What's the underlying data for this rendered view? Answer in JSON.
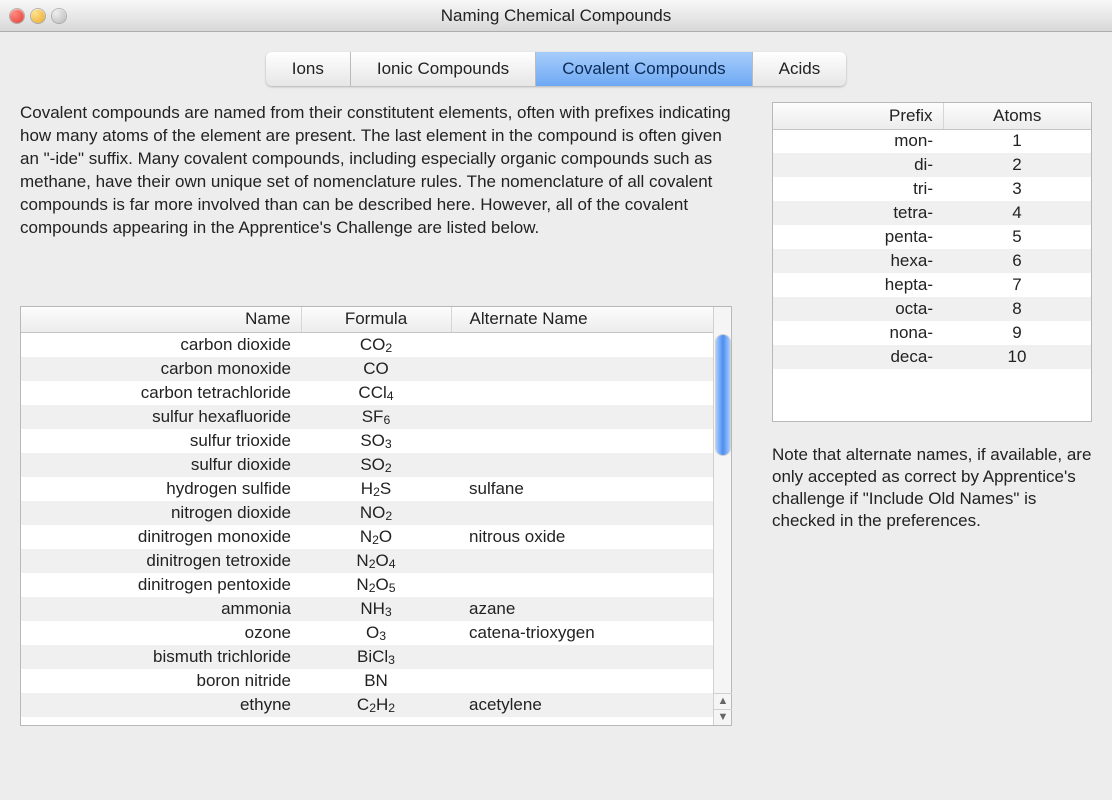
{
  "window": {
    "title": "Naming Chemical Compounds"
  },
  "tabs": [
    {
      "label": "Ions",
      "active": false
    },
    {
      "label": "Ionic Compounds",
      "active": false
    },
    {
      "label": "Covalent Compounds",
      "active": true
    },
    {
      "label": "Acids",
      "active": false
    }
  ],
  "intro": "Covalent compounds are named from their constitutent elements, often with prefixes indicating how many atoms of the element are present.  The last element in the compound is often given an \"-ide\" suffix.  Many covalent compounds, including especially organic compounds such as methane, have their own unique set of nomenclature rules.  The nomenclature of all covalent compounds is far more involved than can be described here.  However, all of the covalent compounds appearing in the Apprentice's Challenge are listed below.",
  "compounds_table": {
    "headers": {
      "name": "Name",
      "formula": "Formula",
      "alt": "Alternate Name"
    },
    "rows": [
      {
        "name": "carbon dioxide",
        "formula": "CO<sub>2</sub>",
        "alt": ""
      },
      {
        "name": "carbon monoxide",
        "formula": "CO",
        "alt": ""
      },
      {
        "name": "carbon tetrachloride",
        "formula": "CCl<sub>4</sub>",
        "alt": ""
      },
      {
        "name": "sulfur hexafluoride",
        "formula": "SF<sub>6</sub>",
        "alt": ""
      },
      {
        "name": "sulfur trioxide",
        "formula": "SO<sub>3</sub>",
        "alt": ""
      },
      {
        "name": "sulfur dioxide",
        "formula": "SO<sub>2</sub>",
        "alt": ""
      },
      {
        "name": "hydrogen sulfide",
        "formula": "H<sub>2</sub>S",
        "alt": "sulfane"
      },
      {
        "name": "nitrogen dioxide",
        "formula": "NO<sub>2</sub>",
        "alt": ""
      },
      {
        "name": "dinitrogen monoxide",
        "formula": "N<sub>2</sub>O",
        "alt": "nitrous oxide"
      },
      {
        "name": "dinitrogen tetroxide",
        "formula": "N<sub>2</sub>O<sub>4</sub>",
        "alt": ""
      },
      {
        "name": "dinitrogen pentoxide",
        "formula": "N<sub>2</sub>O<sub>5</sub>",
        "alt": ""
      },
      {
        "name": "ammonia",
        "formula": "NH<sub>3</sub>",
        "alt": "azane"
      },
      {
        "name": "ozone",
        "formula": "O<sub>3</sub>",
        "alt": "catena-trioxygen"
      },
      {
        "name": "bismuth trichloride",
        "formula": "BiCl<sub>3</sub>",
        "alt": ""
      },
      {
        "name": "boron nitride",
        "formula": "BN",
        "alt": ""
      },
      {
        "name": "ethyne",
        "formula": "C<sub>2</sub>H<sub>2</sub>",
        "alt": "acetylene"
      }
    ]
  },
  "prefix_table": {
    "headers": {
      "prefix": "Prefix",
      "atoms": "Atoms"
    },
    "rows": [
      {
        "prefix": "mon-",
        "atoms": "1"
      },
      {
        "prefix": "di-",
        "atoms": "2"
      },
      {
        "prefix": "tri-",
        "atoms": "3"
      },
      {
        "prefix": "tetra-",
        "atoms": "4"
      },
      {
        "prefix": "penta-",
        "atoms": "5"
      },
      {
        "prefix": "hexa-",
        "atoms": "6"
      },
      {
        "prefix": "hepta-",
        "atoms": "7"
      },
      {
        "prefix": "octa-",
        "atoms": "8"
      },
      {
        "prefix": "nona-",
        "atoms": "9"
      },
      {
        "prefix": "deca-",
        "atoms": "10"
      }
    ]
  },
  "note": "Note that alternate names, if available, are only accepted as correct by Apprentice's challenge if \"Include Old Names\" is checked in the preferences."
}
